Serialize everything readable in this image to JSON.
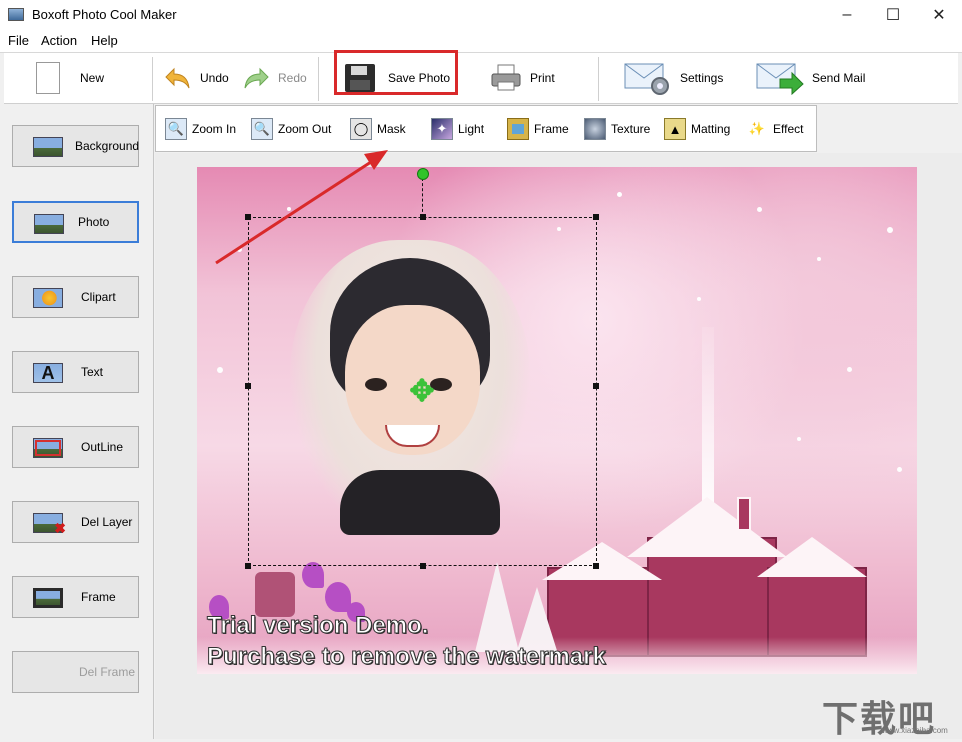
{
  "window": {
    "title": "Boxoft Photo Cool Maker",
    "controls": [
      "minimize-icon",
      "maximize-icon",
      "close-icon"
    ]
  },
  "menu": [
    "File",
    "Action",
    "Help"
  ],
  "toolbar": {
    "new_label": "New",
    "undo_label": "Undo",
    "redo_label": "Redo",
    "save_label": "Save Photo",
    "print_label": "Print",
    "settings_label": "Settings",
    "sendmail_label": "Send Mail"
  },
  "subtoolbar": {
    "zoomin_label": "Zoom In",
    "zoomout_label": "Zoom Out",
    "mask_label": "Mask",
    "light_label": "Light",
    "frame_label": "Frame",
    "texture_label": "Texture",
    "matting_label": "Matting",
    "effect_label": "Effect"
  },
  "sidebar": {
    "items": [
      {
        "label": "Background",
        "state": "normal"
      },
      {
        "label": "Photo",
        "state": "active"
      },
      {
        "label": "Clipart",
        "state": "normal"
      },
      {
        "label": "Text",
        "state": "normal"
      },
      {
        "label": "OutLine",
        "state": "normal"
      },
      {
        "label": "Del Layer",
        "state": "normal"
      },
      {
        "label": "Frame",
        "state": "normal"
      },
      {
        "label": "Del Frame",
        "state": "disabled"
      }
    ]
  },
  "canvas": {
    "watermark_line1": "Trial version Demo.",
    "watermark_line2": "Purchase to remove the watermark"
  },
  "colors": {
    "highlight": "#d9292a",
    "annotation_arrow": "#d9292a",
    "handle_green": "#31c42a",
    "active_border": "#3b7dd8"
  },
  "brand_watermark": {
    "text": "下载吧",
    "url": "www.xiazaiba.com"
  }
}
